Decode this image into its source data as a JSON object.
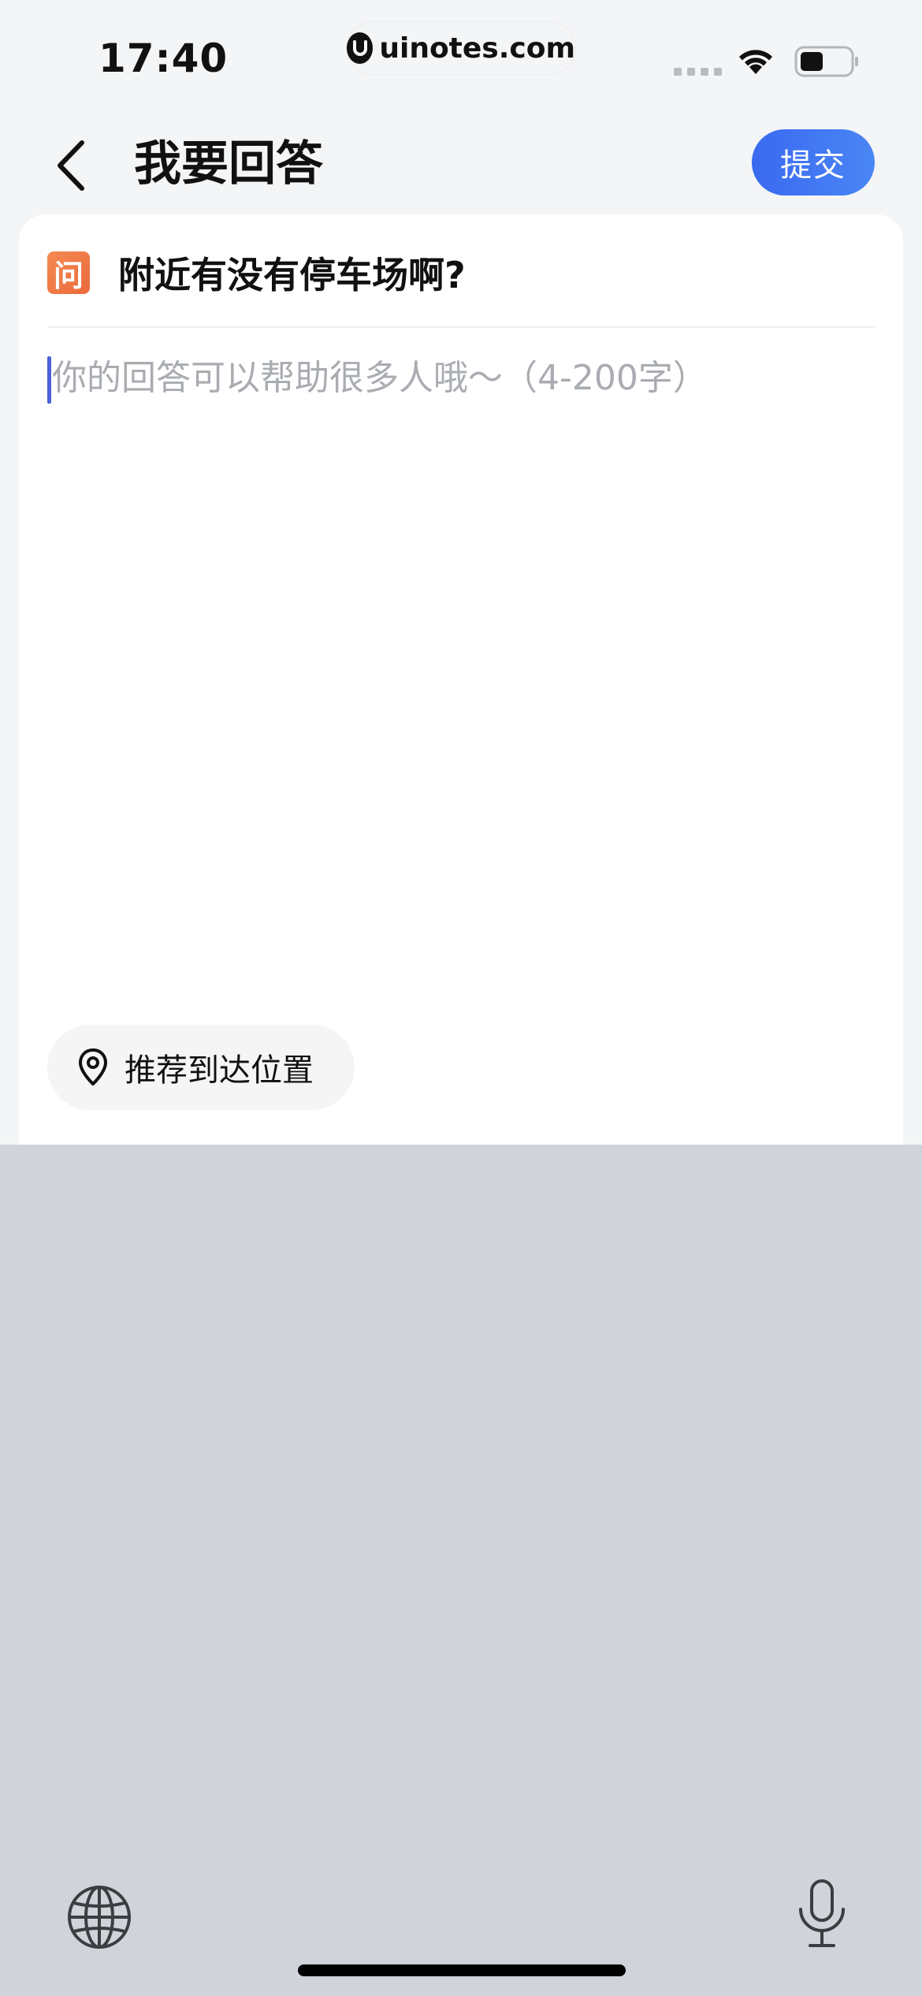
{
  "status_bar": {
    "time": "17:40",
    "url": "uinotes.com"
  },
  "nav": {
    "title": "我要回答",
    "submit_label": "提交"
  },
  "question": {
    "icon_char": "问",
    "text": "附近有没有停车场啊?"
  },
  "answer": {
    "value": "",
    "placeholder": "你的回答可以帮助很多人哦～（4-200字）"
  },
  "location_chip": {
    "label": "推荐到达位置"
  },
  "icons": {
    "back": "chevron-left-icon",
    "wifi": "wifi-icon",
    "battery": "battery-icon",
    "pin": "location-pin-icon",
    "globe": "globe-icon",
    "mic": "microphone-icon"
  },
  "colors": {
    "accent": "#3a69f0",
    "question_badge": "#ee7040",
    "caret": "#4a61d8",
    "keyboard_bg": "#d1d3da"
  }
}
